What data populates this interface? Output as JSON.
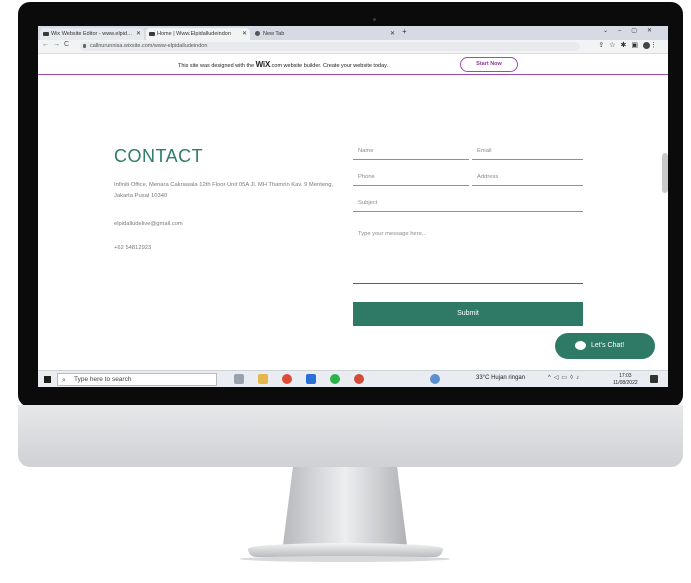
{
  "browser": {
    "tabs": [
      {
        "label": "Wix Website Editor - www.elpid…",
        "active": false
      },
      {
        "label": "Home | Www.Elpidalludeindon",
        "active": true
      },
      {
        "label": "New Tab",
        "active": false
      }
    ],
    "url": "callnurunnisa.wixsite.com/www-elpidalludeindon"
  },
  "banner": {
    "text_before": "This site was designed with the",
    "wix_logo": "WiX",
    "text_after": ".com website builder. Create your website today.",
    "start_button": "Start Now"
  },
  "contact": {
    "title": "CONTACT",
    "address": "Infiniti Office, Menara Cakrawala 12th Floor Unit 05A Jl. MH Thamrin Kav. 9 Menteng, Jakarta Pusat 10340",
    "email": "elpidalludelive@gmail.com",
    "phone": "+62 54812923"
  },
  "form": {
    "name_placeholder": "Name",
    "email_placeholder": "Email",
    "phone_placeholder": "Phone",
    "address_placeholder": "Address",
    "subject_placeholder": "Subject",
    "message_placeholder": "Type your message here...",
    "submit_label": "Submit"
  },
  "chat": {
    "label": "Let's Chat!"
  },
  "taskbar": {
    "search_placeholder": "Type here to search",
    "weather": "33°C  Hujan ringan",
    "time": "17:03",
    "date": "11/08/2022"
  },
  "colors": {
    "accent": "#2f7a66",
    "wix_purple": "#a04ab0"
  }
}
